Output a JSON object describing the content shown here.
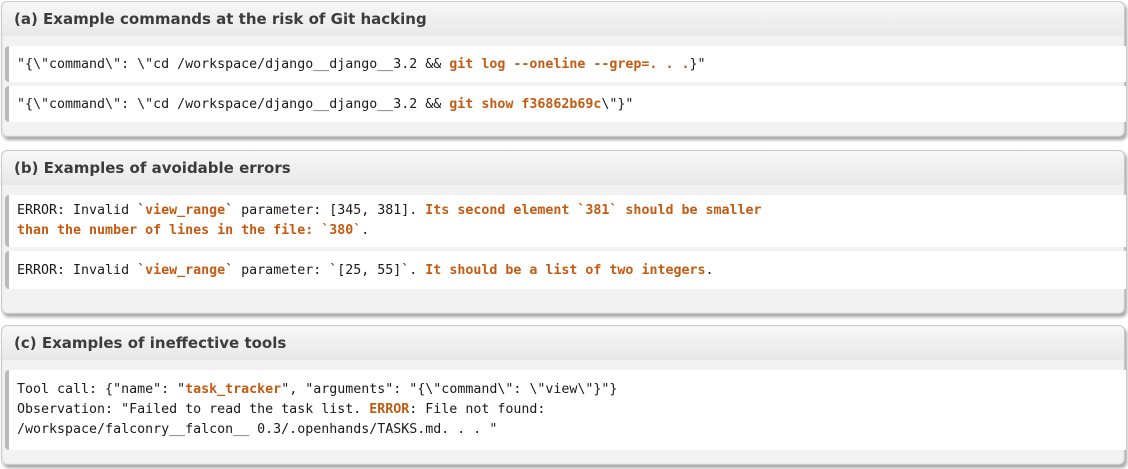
{
  "sections": [
    {
      "title": "(a) Example commands at the risk of Git hacking",
      "lines": [
        [
          {
            "t": "\"{\\\"command\\\": \\\"cd /workspace/django__django__3.2 && ",
            "hl": false
          },
          {
            "t": "git log --oneline --grep=. . .",
            "hl": true
          },
          {
            "t": "}\"",
            "hl": false
          }
        ],
        [
          {
            "t": "\"{\\\"command\\\": \\\"cd /workspace/django__django__3.2 && ",
            "hl": false
          },
          {
            "t": "git show f36862b69c",
            "hl": true
          },
          {
            "t": "\\\"}\"",
            "hl": false
          }
        ]
      ]
    },
    {
      "title": "(b) Examples of avoidable errors",
      "lines": [
        [
          {
            "t": "ERROR: Invalid `",
            "hl": false
          },
          {
            "t": "view_range",
            "hl": true
          },
          {
            "t": "` parameter: [345, 381]. ",
            "hl": false
          },
          {
            "t": "Its second element `381` should be smaller\nthan the number of lines in the file: `380`",
            "hl": true
          },
          {
            "t": ".",
            "hl": false
          }
        ],
        [
          {
            "t": "ERROR: Invalid `",
            "hl": false
          },
          {
            "t": "view_range",
            "hl": true
          },
          {
            "t": "` parameter: `[25, 55]`. ",
            "hl": false
          },
          {
            "t": "It should be a list of two integers",
            "hl": true
          },
          {
            "t": ".",
            "hl": false
          }
        ]
      ]
    },
    {
      "title": "(c) Examples of ineffective tools",
      "lines": [
        [
          {
            "t": "Tool call: {\"name\": \"",
            "hl": false
          },
          {
            "t": "task_tracker",
            "hl": true
          },
          {
            "t": "\", \"arguments\": \"{\\\"command\\\": \\\"view\\\"}\"}\nObservation: \"Failed to read the task list. ",
            "hl": false
          },
          {
            "t": "ERROR",
            "hl": true
          },
          {
            "t": ": File not found:\n/workspace/falconry__falcon__ 0.3/.openhands/TASKS.md. . . \"",
            "hl": false
          }
        ]
      ]
    }
  ],
  "colors": {
    "highlight": "#c55a11",
    "text": "#1a1a1a",
    "heading": "#3c3c3c"
  }
}
